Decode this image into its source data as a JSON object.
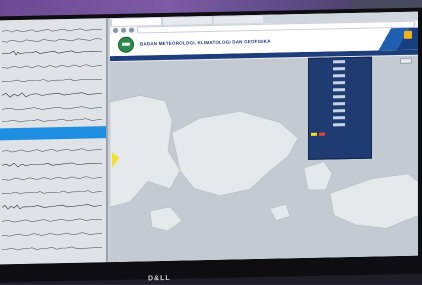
{
  "monitor": {
    "brand": "D&LL"
  },
  "browser": {
    "tabs": [
      "",
      "",
      ""
    ],
    "address": ""
  },
  "header": {
    "agency": "BADAN METEOROLOGI, KLIMATOLOGI DAN GEOFISIKA",
    "motto": ""
  },
  "menu": [],
  "legend": {
    "rows": [],
    "colors": [
      "#f4e22a",
      "#e84a2a"
    ]
  },
  "colors": {
    "header_blue": "#1d3d7d",
    "seis_highlight": "#1e8fe0",
    "map_land": "#e6e9ec",
    "map_water": "#c4cad1"
  }
}
